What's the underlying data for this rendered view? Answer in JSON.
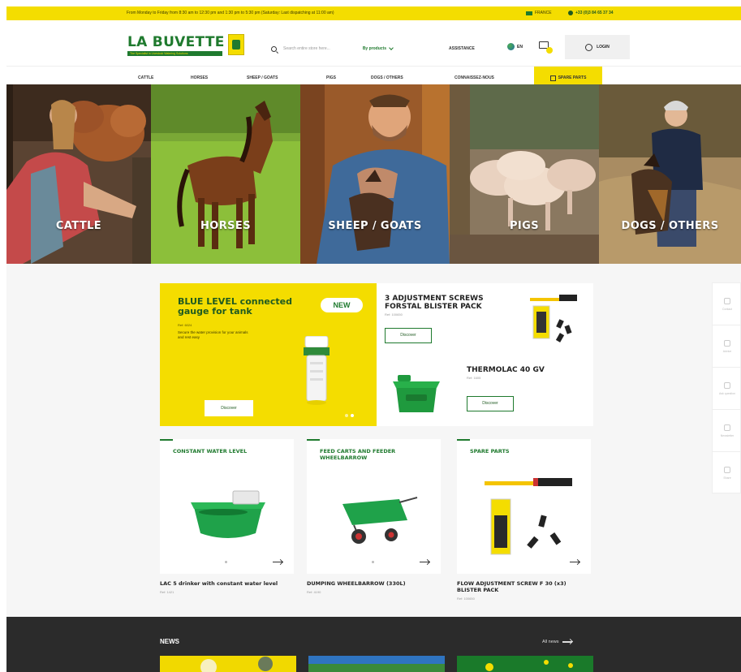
{
  "topbar": {
    "schedule": "From Monday to Friday from 8:30 am to 12:30 pm and 1:30 pm to 5:30 pm (Saturday: Last dispatching at 11:00 am)",
    "country": "FRANCE",
    "phone": "+33 (0)3 84 65 37 34"
  },
  "header": {
    "logo_text": "LA BUVETTE",
    "logo_tagline": "The Specialist in Livestock Watering Solutions",
    "search_placeholder": "Search entire store here...",
    "search_scope": "By products",
    "assistance": "ASSISTANCE",
    "language": "EN",
    "login": "LOGIN"
  },
  "nav": {
    "items": [
      "CATTLE",
      "HORSES",
      "SHEEP / GOATS",
      "PIGS",
      "DOGS / OTHERS",
      "CONNAISSEZ-NOUS"
    ],
    "spare_parts": "SPARE PARTS"
  },
  "categories": [
    {
      "label": "CATTLE"
    },
    {
      "label": "HORSES"
    },
    {
      "label": "SHEEP / GOATS"
    },
    {
      "label": "PIGS"
    },
    {
      "label": "DOGS / OTHERS"
    }
  ],
  "promo": {
    "main": {
      "title": "BLUE LEVEL connected gauge for tank",
      "ref": "Ref: 6024",
      "description": "Secure the water provision for your animals and rest easy",
      "badge": "NEW",
      "button": "Discover"
    },
    "second": {
      "title": "3 ADJUSTMENT SCREWS FORSTAL BLISTER PACK",
      "ref": "Ref: 100650",
      "button": "Discover"
    },
    "third": {
      "title": "THERMOLAC 40 GV",
      "ref": "Ref: 1605",
      "button": "Discover"
    }
  },
  "featured": [
    {
      "category": "CONSTANT WATER LEVEL",
      "product": "LAC 5 drinker with constant water level",
      "ref": "Ref: 1421"
    },
    {
      "category": "FEED CARTS AND FEEDER WHEELBARROW",
      "product": "DUMPING WHEELBARROW (330L)",
      "ref": "Ref: 4190"
    },
    {
      "category": "SPARE PARTS",
      "product": "FLOW ADJUSTMENT SCREW F 30 (x3) BLISTER PACK",
      "ref": "Ref: 100650"
    }
  ],
  "side_tools": [
    "Contact",
    "Advice",
    "Ask question",
    "Newsletter",
    "Share"
  ],
  "news": {
    "heading": "NEWS",
    "all_news": "All news"
  },
  "colors": {
    "brand_green": "#1f7a2e",
    "brand_yellow": "#f4dd00",
    "news_bg": "#2b2b2b"
  }
}
